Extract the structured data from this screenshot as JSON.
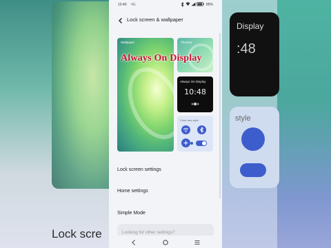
{
  "background": {
    "left_caption": "Lock scre",
    "right_aod_label": "Display",
    "right_aod_time": ":48",
    "right_style_label": "style"
  },
  "status_bar": {
    "time": "10:40",
    "network": "4G",
    "battery": "85%"
  },
  "header": {
    "title": "Lock screen & wallpaper"
  },
  "cards": {
    "wallpaper_label": "Wallpaper",
    "themes_label": "Themes",
    "aod_label": "Always On Display",
    "aod_time": "10:48",
    "color_style_label": "Color and style"
  },
  "overlay_text": "Always On Display",
  "menu": {
    "items": [
      {
        "label": "Lock screen settings"
      },
      {
        "label": "Home settings"
      },
      {
        "label": "Simple Mode"
      }
    ]
  },
  "search": {
    "placeholder": "Looking for other settings?"
  },
  "colors": {
    "accent": "#3e5dcc",
    "overlay_text": "#c8102e",
    "page_bg": "#f3f4f8"
  },
  "icons": [
    "back-arrow-icon",
    "wifi-icon",
    "bluetooth-icon",
    "plus-icon",
    "toggle-icon",
    "nav-back-icon",
    "nav-home-icon",
    "nav-menu-icon"
  ]
}
